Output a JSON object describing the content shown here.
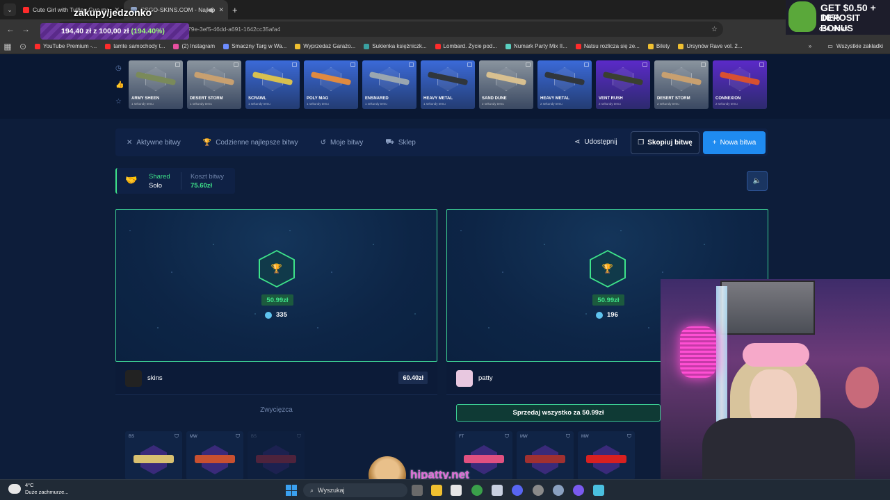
{
  "browser": {
    "tabs": [
      {
        "title": "Cute Girl with Tulling Gun ma",
        "color": "#ff2b2b"
      },
      {
        "title": "CSGO-SKINS.COM - Najlep",
        "color": "#8fa3c6"
      }
    ],
    "url": "79e-3ef5-46dd-a691-1642cc35afa4",
    "bookmarks": [
      {
        "label": "YouTube Premium -...",
        "color": "#ff2b2b"
      },
      {
        "label": "tamte samochody t...",
        "color": "#ff2b2b"
      },
      {
        "label": "(2) Instagram",
        "color": "#e84fa0"
      },
      {
        "label": "Smaczny Targ w Wa...",
        "color": "#6c8cff"
      },
      {
        "label": "Wyprzedaż Garażo...",
        "color": "#f0c030"
      },
      {
        "label": "Sukienka księżniczk...",
        "color": "#3aa0a0"
      },
      {
        "label": "Lombard. Życie pod...",
        "color": "#ff2b2b"
      },
      {
        "label": "Numark Party Mix II...",
        "color": "#5ad0c0"
      },
      {
        "label": "Natsu rozlicza się ze...",
        "color": "#ff2b2b"
      },
      {
        "label": "Bilety",
        "color": "#f0c030"
      },
      {
        "label": "Ursynów Rave vol. 2...",
        "color": "#f0c030"
      }
    ],
    "all_bookmarks": "Wszystkie zakładki"
  },
  "overlay": {
    "title": "zakupy/jedzonko",
    "progress_text": "194,40 zł z 100,00 zł",
    "progress_pct": "(194.40%)",
    "progress_value": 1.944,
    "ad_line1": "GET $0.50 + 10%",
    "ad_line2": "DEPOSIT BONUS",
    "ad_brand": "CSG SKINS"
  },
  "live_drops": [
    {
      "name": "ARMY SHEEN",
      "time": "1 sekundy temu",
      "bg": "#8a949e",
      "gun": "#7a8a5a"
    },
    {
      "name": "DESERT STORM",
      "time": "1 sekundy temu",
      "bg": "#8a949e",
      "gun": "#c8a070"
    },
    {
      "name": "SCRAWL",
      "time": "1 sekundy temu",
      "bg": "#3b6ad8",
      "gun": "#d8c050"
    },
    {
      "name": "POLY MAG",
      "time": "1 sekundy temu",
      "bg": "#3b6ad8",
      "gun": "#e08a40"
    },
    {
      "name": "ENSNARED",
      "time": "1 sekundy temu",
      "bg": "#3b6ad8",
      "gun": "#9aa6b0"
    },
    {
      "name": "HEAVY METAL",
      "time": "1 sekundy temu",
      "bg": "#3b6ad8",
      "gun": "#30363c"
    },
    {
      "name": "SAND DUNE",
      "time": "2 sekundy temu",
      "bg": "#8a949e",
      "gun": "#d8c090"
    },
    {
      "name": "HEAVY METAL",
      "time": "2 sekundy temu",
      "bg": "#3b6ad8",
      "gun": "#30363c"
    },
    {
      "name": "VENT RUSH",
      "time": "2 sekundy temu",
      "bg": "#5b2ac8",
      "gun": "#3a4030"
    },
    {
      "name": "DESERT STORM",
      "time": "2 sekundy temu",
      "bg": "#8a949e",
      "gun": "#c8a070"
    },
    {
      "name": "CONNEXION",
      "time": "2 sekundy temu",
      "bg": "#5b2ac8",
      "gun": "#d85030"
    }
  ],
  "nav": {
    "tabs": [
      "Aktywne bitwy",
      "Codzienne najlepsze bitwy",
      "Moje bitwy",
      "Sklep"
    ],
    "share": "Udostępnij",
    "copy": "Skopiuj bitwę",
    "new": "Nowa bitwa"
  },
  "battle": {
    "mode_top": "Shared",
    "mode_bottom": "Solo",
    "cost_label": "Koszt bitwy",
    "cost_value": "75.60zł"
  },
  "players": [
    {
      "amount": "50.99zł",
      "coins": "335",
      "name": "skins",
      "value": "60.40zł",
      "avatar": "#222222"
    },
    {
      "amount": "50.99zł",
      "coins": "196",
      "name": "patty",
      "value": "",
      "avatar": "#e8c8e0"
    }
  ],
  "winner_label": "Zwycięzca",
  "sell_label": "Sprzedaj wszystko za 50.99zł",
  "items_left": [
    {
      "cond": "BS",
      "gun": "#d8c070",
      "dim": false
    },
    {
      "cond": "MW",
      "gun": "#c85030",
      "dim": false
    },
    {
      "cond": "BS",
      "gun": "#c83040",
      "dim": true
    }
  ],
  "items_right": [
    {
      "cond": "FT",
      "gun": "#e05080"
    },
    {
      "cond": "MW",
      "gun": "#a03030"
    },
    {
      "cond": "MW",
      "gun": "#d82020"
    }
  ],
  "stream": {
    "handle": "hipatty.net"
  },
  "taskbar": {
    "temp": "4°C",
    "weather": "Duże zachmurze...",
    "search": "Wyszukaj"
  }
}
